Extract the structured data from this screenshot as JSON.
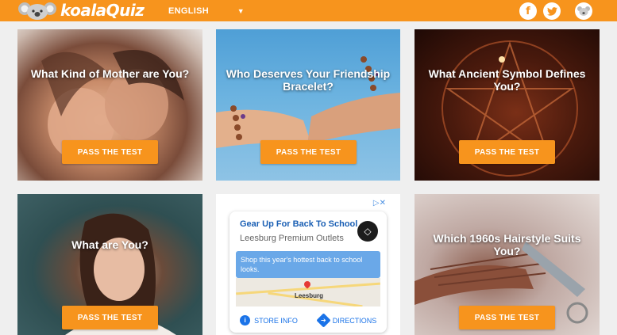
{
  "header": {
    "brand": "koalaQuiz",
    "language": "ENGLISH",
    "social": {
      "facebook": "f",
      "twitter": "t"
    }
  },
  "quizzes": [
    {
      "title": "What Kind of Mother are You?",
      "button": "PASS THE TEST"
    },
    {
      "title": "Who Deserves Your Friendship Bracelet?",
      "button": "PASS THE TEST"
    },
    {
      "title": "What Ancient Symbol Defines You?",
      "button": "PASS THE TEST"
    },
    {
      "title": "What are You?",
      "button": "PASS THE TEST"
    },
    {
      "title": "Which 1960s Hairstyle Suits You?",
      "button": "PASS THE TEST"
    }
  ],
  "ad": {
    "headline": "Gear Up For Back To School",
    "advertiser": "Leesburg Premium Outlets",
    "message": "Shop this year's hottest back to school looks.",
    "map_label": "Leesburg",
    "store_info": "STORE INFO",
    "directions": "DIRECTIONS"
  },
  "colors": {
    "accent": "#f7941d",
    "link": "#1a73e8"
  },
  "icons": {
    "ad_choices": "ad-choices-icon",
    "language_caret": "chevron-down-icon"
  }
}
